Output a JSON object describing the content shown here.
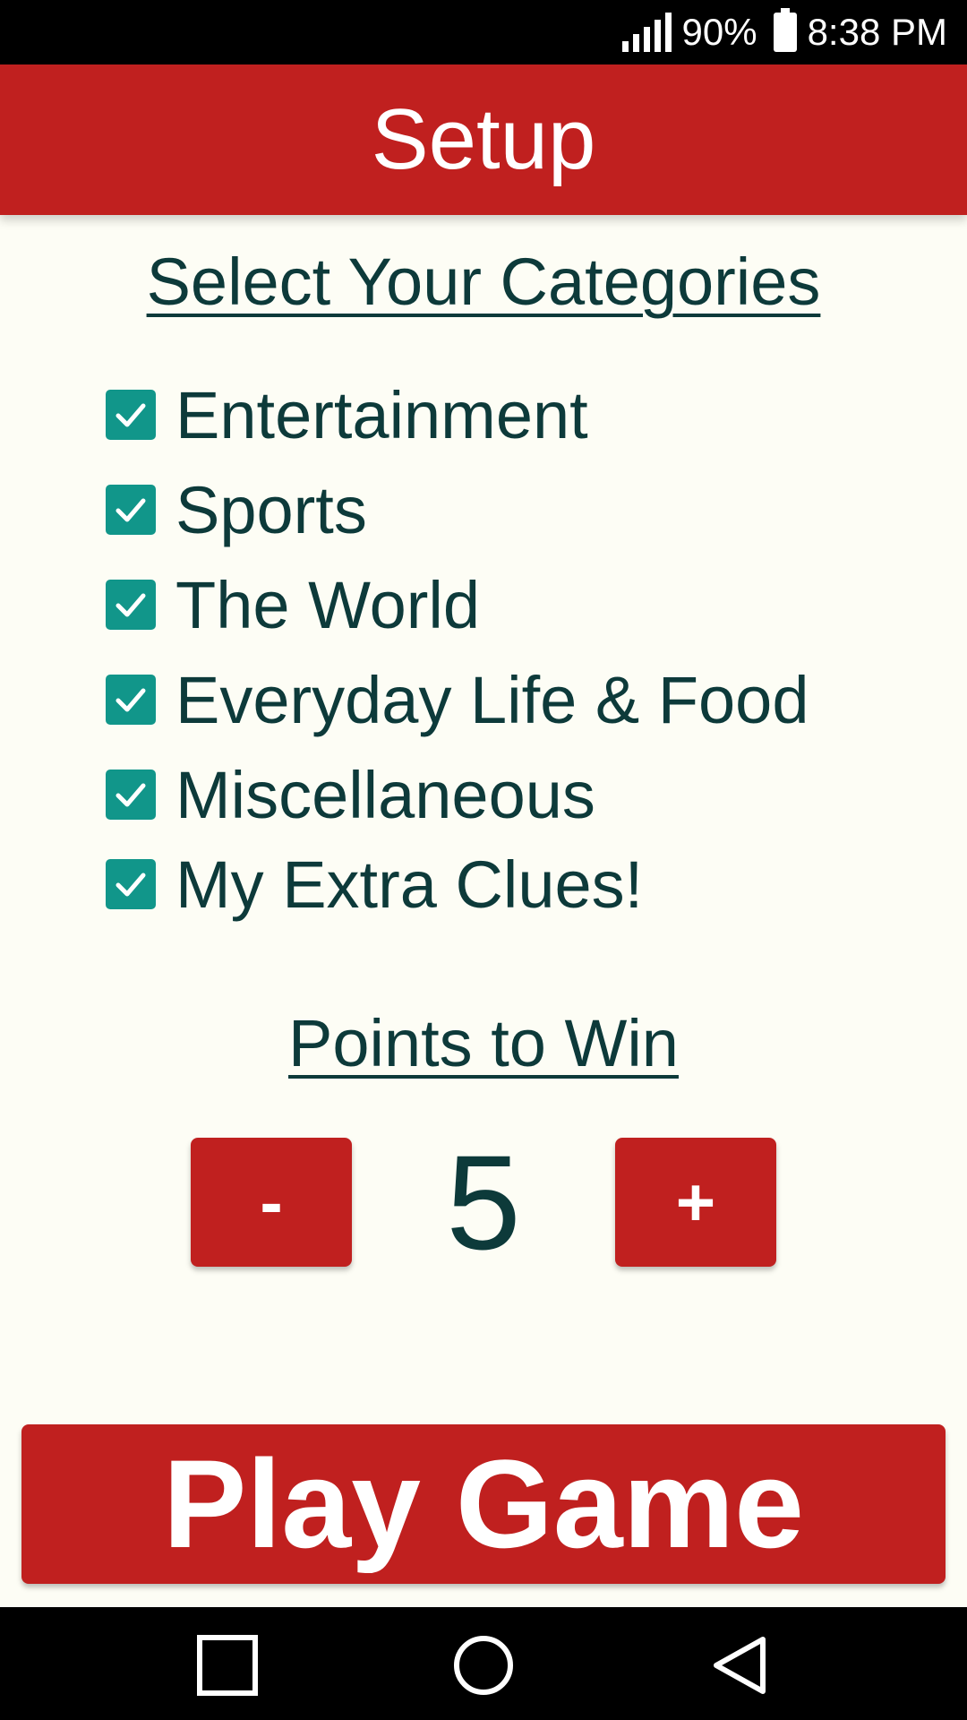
{
  "status_bar": {
    "battery_percent": "90%",
    "time": "8:38 PM"
  },
  "app_bar": {
    "title": "Setup"
  },
  "categories": {
    "heading": "Select Your Categories",
    "items": [
      {
        "label": "Entertainment",
        "checked": true
      },
      {
        "label": "Sports",
        "checked": true
      },
      {
        "label": "The World",
        "checked": true
      },
      {
        "label": "Everyday Life & Food",
        "checked": true
      },
      {
        "label": "Miscellaneous",
        "checked": true
      },
      {
        "label": "My Extra Clues!",
        "checked": true
      }
    ]
  },
  "points": {
    "heading": "Points to Win",
    "minus_label": "-",
    "plus_label": "+",
    "value": "5"
  },
  "play_button": {
    "label": "Play Game"
  },
  "colors": {
    "primary_red": "#c0201f",
    "checkbox_teal": "#11968a",
    "text_dark": "#0d3a3a",
    "background": "#fdfdf5"
  },
  "icons": {
    "signal": "signal-icon",
    "battery": "battery-icon",
    "check": "check-icon",
    "nav_recents": "square-icon",
    "nav_home": "circle-icon",
    "nav_back": "triangle-back-icon"
  }
}
